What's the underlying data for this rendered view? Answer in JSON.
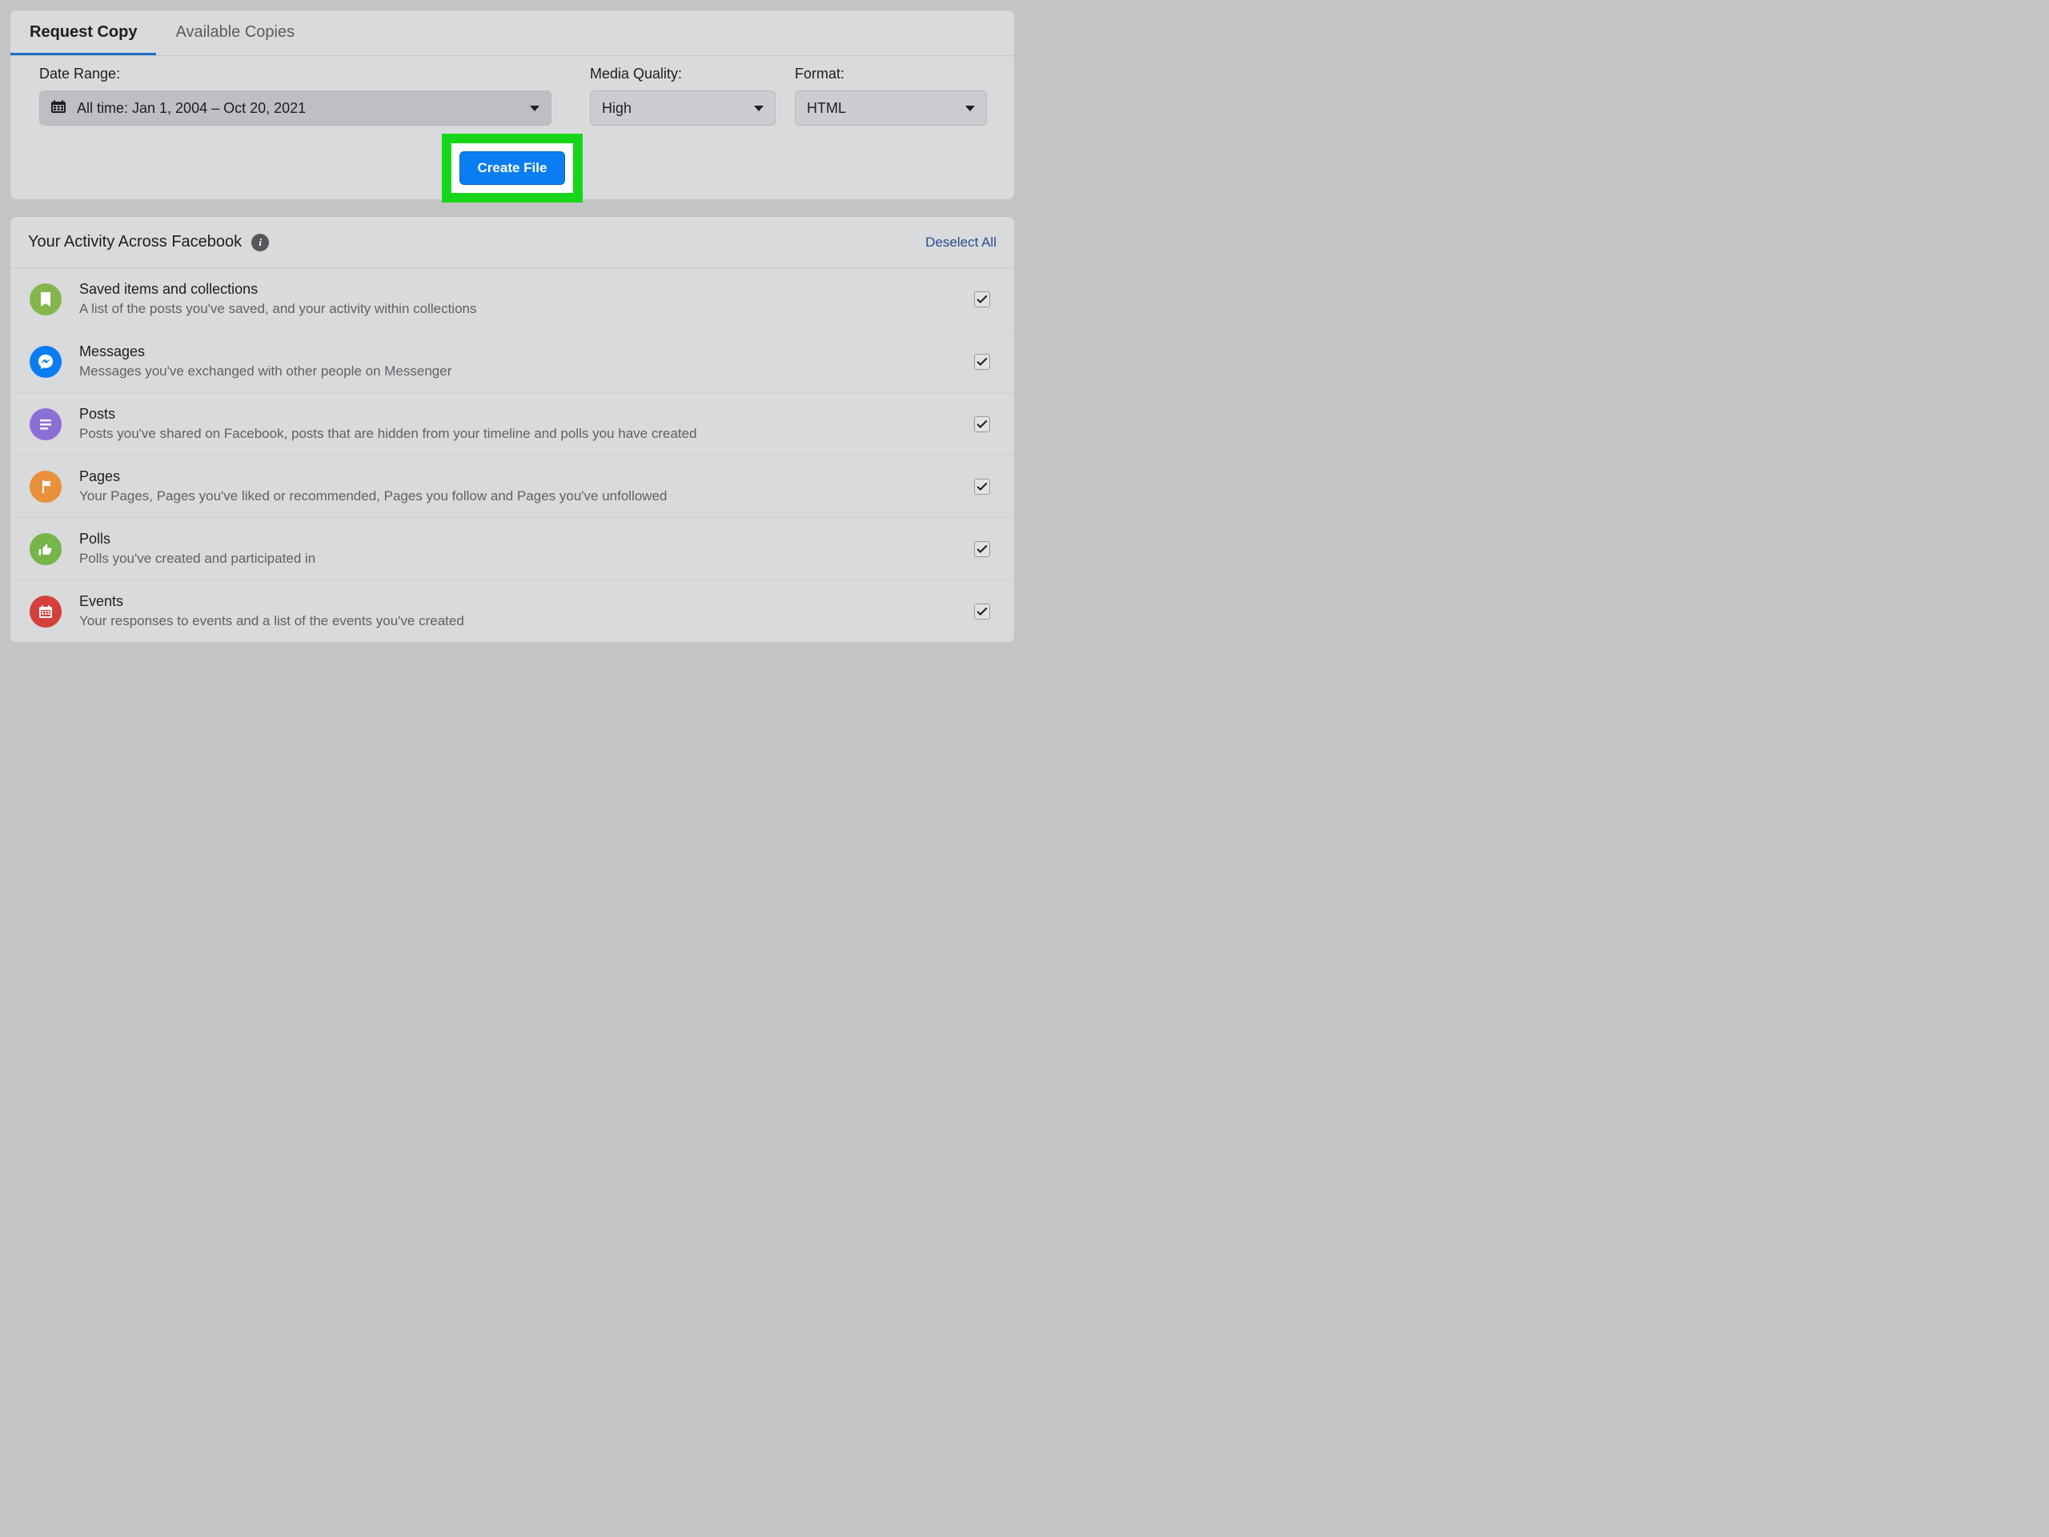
{
  "tabs": {
    "request": "Request Copy",
    "available": "Available Copies"
  },
  "labels": {
    "date_range": "Date Range:",
    "media_quality": "Media Quality:",
    "format": "Format:"
  },
  "values": {
    "date_range": "All time: Jan 1, 2004 – Oct 20, 2021",
    "media_quality": "High",
    "format": "HTML"
  },
  "create_button": "Create File",
  "activity": {
    "title": "Your Activity Across Facebook",
    "deselect": "Deselect All",
    "items": [
      {
        "title": "Saved items and collections",
        "desc": "A list of the posts you've saved, and your activity within collections",
        "icon": "saved"
      },
      {
        "title": "Messages",
        "desc": "Messages you've exchanged with other people on Messenger",
        "icon": "msg"
      },
      {
        "title": "Posts",
        "desc": "Posts you've shared on Facebook, posts that are hidden from your timeline and polls you have created",
        "icon": "posts"
      },
      {
        "title": "Pages",
        "desc": "Your Pages, Pages you've liked or recommended, Pages you follow and Pages you've unfollowed",
        "icon": "pages"
      },
      {
        "title": "Polls",
        "desc": "Polls you've created and participated in",
        "icon": "polls"
      },
      {
        "title": "Events",
        "desc": "Your responses to events and a list of the events you've created",
        "icon": "events"
      }
    ]
  }
}
